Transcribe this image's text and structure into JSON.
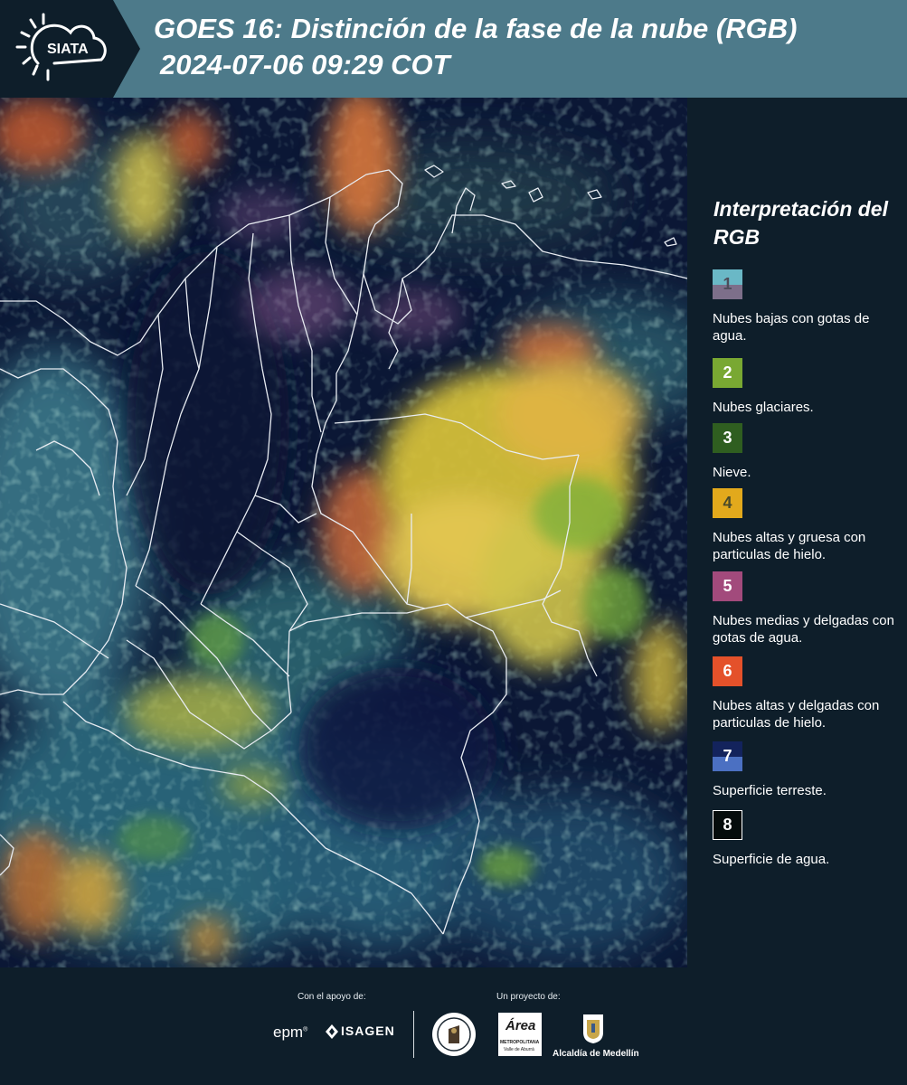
{
  "header": {
    "logo_text": "SIATA",
    "title_line1": "GOES 16: Distinción de la fase de la nube (RGB)",
    "title_line2": "2024-07-06 09:29 COT",
    "bg_color": "#4d7a8a"
  },
  "legend": {
    "title": "Interpretación del RGB",
    "items": [
      {
        "number": "1",
        "label": "Nubes bajas con gotas de agua.",
        "colors": [
          "#6ab8c6",
          "#7d6f8a"
        ]
      },
      {
        "number": "2",
        "label": "Nubes glaciares.",
        "colors": [
          "#79a832"
        ]
      },
      {
        "number": "3",
        "label": "Nieve.",
        "colors": [
          "#2f5e20"
        ]
      },
      {
        "number": "4",
        "label": "Nubes altas y gruesa con particulas de hielo.",
        "colors": [
          "#e2a91c"
        ]
      },
      {
        "number": "5",
        "label": "Nubes medias y delgadas con gotas de agua.",
        "colors": [
          "#a24a7c"
        ]
      },
      {
        "number": "6",
        "label": "Nubes altas y delgadas con particulas de hielo.",
        "colors": [
          "#e4512a"
        ]
      },
      {
        "number": "7",
        "label": "Superficie terreste.",
        "colors": [
          "#13235c",
          "#4b70c2"
        ]
      },
      {
        "number": "8",
        "label": "Superficie de agua.",
        "colors": [
          "#050c0c"
        ]
      }
    ]
  },
  "footer": {
    "support_label": "Con el apoyo de:",
    "project_label": "Un proyecto de:",
    "sponsor_epm": "epm",
    "sponsor_epm_mark": "®",
    "sponsor_isagen": "ISAGEN",
    "area_logo_text": "Área",
    "area_logo_sub1": "METROPOLITANA",
    "area_logo_sub2": "Valle de Aburrá",
    "alcaldia": "Alcaldía de Medellín"
  }
}
